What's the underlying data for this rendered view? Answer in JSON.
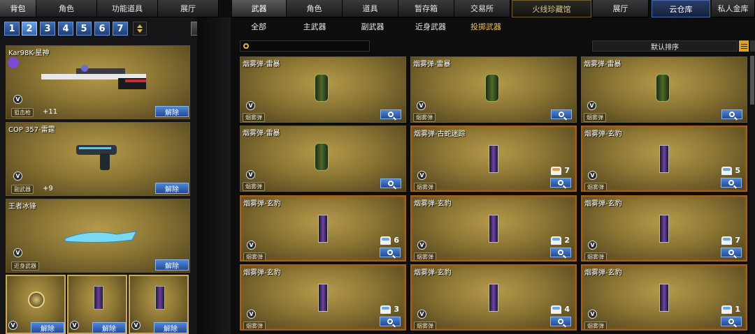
{
  "left_tabs": [
    "背包",
    "角色",
    "功能道具",
    "展厅"
  ],
  "main_tabs": [
    "武器",
    "角色",
    "道具",
    "暂存箱",
    "交易所",
    "火线珍藏馆",
    "展厅"
  ],
  "storage_tabs": [
    "云仓库",
    "私人金库"
  ],
  "pages": [
    "1",
    "2",
    "3",
    "4",
    "5",
    "6",
    "7"
  ],
  "active_page": "2",
  "sub_tabs": [
    "全部",
    "主武器",
    "副武器",
    "近身武器",
    "投掷武器"
  ],
  "active_sub_tab": "投掷武器",
  "search": {
    "placeholder": ""
  },
  "sort": {
    "label": "默认排序"
  },
  "equipped": [
    {
      "name": "Kar98K-星神",
      "type": "狙击枪",
      "level": "+11",
      "remove": "解除"
    },
    {
      "name": "COP 357-雷霆",
      "type": "副武器",
      "level": "+9",
      "remove": "解除"
    },
    {
      "name": "王者冰锋",
      "type": "近身武器",
      "level": "",
      "remove": "解除"
    }
  ],
  "equipped_small": [
    {
      "remove": "解除"
    },
    {
      "remove": "解除"
    },
    {
      "remove": "解除"
    }
  ],
  "items": [
    {
      "name": "烟雾弹-雷暴",
      "tag": "烟雾弹",
      "count": ""
    },
    {
      "name": "烟雾弹-雷暴",
      "tag": "烟雾弹",
      "count": ""
    },
    {
      "name": "烟雾弹-雷暴",
      "tag": "烟雾弹",
      "count": ""
    },
    {
      "name": "烟雾弹-雷暴",
      "tag": "烟雾弹",
      "count": ""
    },
    {
      "name": "烟雾弹-古蛇迷踪",
      "tag": "烟雾弹",
      "count": "7"
    },
    {
      "name": "烟雾弹-玄豹",
      "tag": "烟雾弹",
      "count": "5"
    },
    {
      "name": "烟雾弹-玄豹",
      "tag": "烟雾弹",
      "count": "6"
    },
    {
      "name": "烟雾弹-玄豹",
      "tag": "烟雾弹",
      "count": "2"
    },
    {
      "name": "烟雾弹-玄豹",
      "tag": "烟雾弹",
      "count": "7"
    },
    {
      "name": "烟雾弹-玄豹",
      "tag": "烟雾弹",
      "count": "3"
    },
    {
      "name": "烟雾弹-玄豹",
      "tag": "烟雾弹",
      "count": "4"
    },
    {
      "name": "烟雾弹-玄豹",
      "tag": "烟雾弹",
      "count": "1"
    }
  ],
  "v_badge": "V"
}
